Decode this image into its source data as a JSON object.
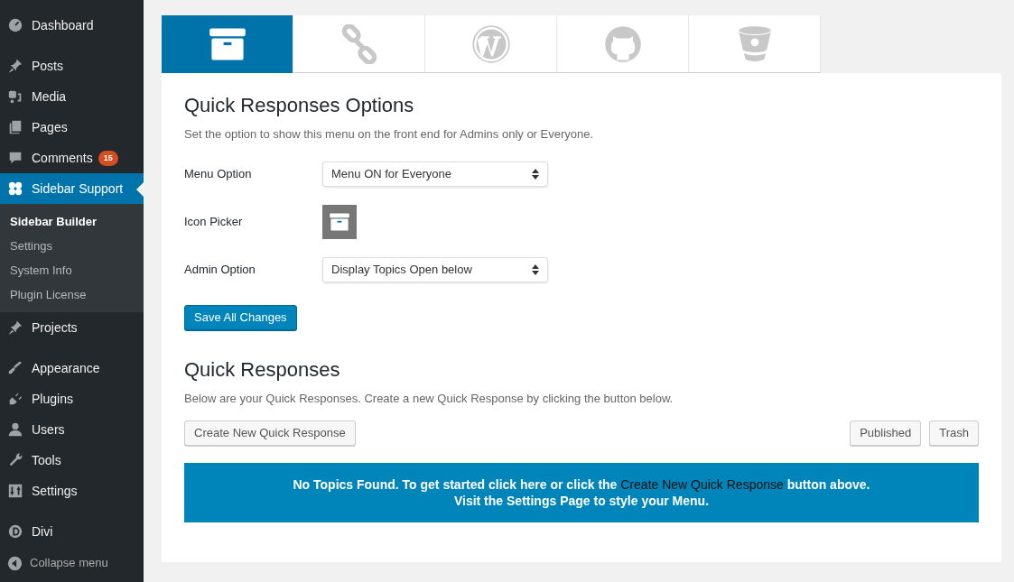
{
  "sidebar": {
    "groups": [
      [
        {
          "label": "Dashboard",
          "kind": "gauge",
          "selected": false
        }
      ],
      [
        {
          "label": "Posts",
          "kind": "pin",
          "selected": false
        },
        {
          "label": "Media",
          "kind": "media",
          "selected": false
        },
        {
          "label": "Pages",
          "kind": "pages",
          "selected": false
        },
        {
          "label": "Comments",
          "kind": "comment",
          "selected": false,
          "badge": "15"
        },
        {
          "label": "Sidebar Support",
          "kind": "clover",
          "selected": true,
          "children": [
            {
              "label": "Sidebar Builder",
              "selected": true
            },
            {
              "label": "Settings",
              "selected": false
            },
            {
              "label": "System Info",
              "selected": false
            },
            {
              "label": "Plugin License",
              "selected": false
            }
          ]
        },
        {
          "label": "Projects",
          "kind": "pin",
          "selected": false
        }
      ],
      [
        {
          "label": "Appearance",
          "kind": "brush",
          "selected": false
        },
        {
          "label": "Plugins",
          "kind": "plug",
          "selected": false
        },
        {
          "label": "Users",
          "kind": "user",
          "selected": false
        },
        {
          "label": "Tools",
          "kind": "wrench",
          "selected": false
        },
        {
          "label": "Settings",
          "kind": "sliders",
          "selected": false
        }
      ],
      [
        {
          "label": "Divi",
          "kind": "divi",
          "selected": false
        }
      ]
    ],
    "collapse": "Collapse menu"
  },
  "tabs": [
    {
      "kind": "box",
      "selected": true
    },
    {
      "kind": "link",
      "selected": false
    },
    {
      "kind": "wp",
      "selected": false
    },
    {
      "kind": "octocat",
      "selected": false
    },
    {
      "kind": "bucket",
      "selected": false
    }
  ],
  "options": {
    "title": "Quick Responses Options",
    "description": "Set the option to show this menu on the front end for Admins only or Everyone.",
    "fields": [
      {
        "kind": "select",
        "label": "Menu Option",
        "value": "Menu ON for Everyone"
      },
      {
        "kind": "icon",
        "label": "Icon Picker"
      },
      {
        "kind": "select",
        "label": "Admin Option",
        "value": "Display Topics Open below"
      }
    ],
    "save": "Save All Changes"
  },
  "responses": {
    "title": "Quick Responses",
    "description": "Below are your Quick Responses. Create a new Quick Response by clicking the button below.",
    "create": "Create New Quick Response",
    "filters": [
      "Published",
      "Trash"
    ],
    "notice": {
      "before": "No Topics Found. To get started click here or click the",
      "link": "Create New Quick Response",
      "after": "button above.",
      "line2": "Visit the Settings Page to style your Menu."
    }
  }
}
